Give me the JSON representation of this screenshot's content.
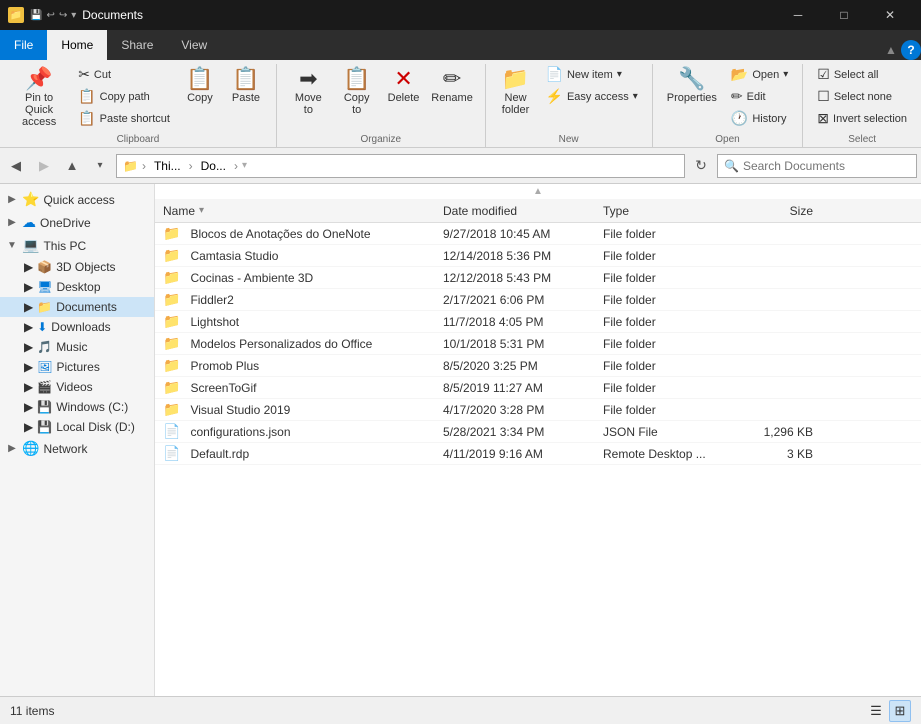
{
  "titleBar": {
    "title": "Documents",
    "controls": {
      "minimize": "─",
      "maximize": "□",
      "close": "✕"
    }
  },
  "ribbonTabs": [
    {
      "id": "file",
      "label": "File",
      "type": "file"
    },
    {
      "id": "home",
      "label": "Home",
      "type": "active"
    },
    {
      "id": "share",
      "label": "Share"
    },
    {
      "id": "view",
      "label": "View"
    }
  ],
  "ribbon": {
    "groups": {
      "clipboard": {
        "label": "Clipboard",
        "pinToQuickAccess": "Pin to Quick access",
        "copy": "Copy",
        "paste": "Paste",
        "cut": "Cut",
        "copyPath": "Copy path",
        "pasteShortcut": "Paste shortcut"
      },
      "organize": {
        "label": "Organize",
        "moveTo": "Move to",
        "copyTo": "Copy to",
        "delete": "Delete",
        "rename": "Rename"
      },
      "new": {
        "label": "New",
        "newFolder": "New folder",
        "newItem": "New item",
        "easyAccess": "Easy access"
      },
      "open": {
        "label": "Open",
        "properties": "Properties",
        "open": "Open",
        "edit": "Edit",
        "history": "History"
      },
      "select": {
        "label": "Select",
        "selectAll": "Select all",
        "selectNone": "Select none",
        "invertSelection": "Invert selection"
      }
    }
  },
  "addressBar": {
    "backDisabled": false,
    "forwardDisabled": true,
    "upLabel": "Up",
    "paths": [
      "This...",
      "Do...",
      ""
    ],
    "searchPlaceholder": "Search Documents",
    "refreshLabel": "Refresh"
  },
  "sidebar": {
    "items": [
      {
        "id": "quick-access",
        "label": "Quick access",
        "icon": "⭐",
        "expand": "▶",
        "expanded": false
      },
      {
        "id": "onedrive",
        "label": "OneDrive",
        "icon": "☁",
        "expand": "▶",
        "expanded": false
      },
      {
        "id": "this-pc",
        "label": "This PC",
        "icon": "💻",
        "expand": "▼",
        "expanded": true
      },
      {
        "id": "3d-objects",
        "label": "3D Objects",
        "icon": "📦",
        "expand": "▶",
        "child": true
      },
      {
        "id": "desktop",
        "label": "Desktop",
        "icon": "🖥",
        "expand": "▶",
        "child": true
      },
      {
        "id": "documents",
        "label": "Documents",
        "icon": "📁",
        "expand": "▶",
        "child": true,
        "active": true
      },
      {
        "id": "downloads",
        "label": "Downloads",
        "icon": "⬇",
        "expand": "▶",
        "child": true
      },
      {
        "id": "music",
        "label": "Music",
        "icon": "🎵",
        "expand": "▶",
        "child": true
      },
      {
        "id": "pictures",
        "label": "Pictures",
        "icon": "🖼",
        "expand": "▶",
        "child": true
      },
      {
        "id": "videos",
        "label": "Videos",
        "icon": "🎬",
        "expand": "▶",
        "child": true
      },
      {
        "id": "windows-c",
        "label": "Windows (C:)",
        "icon": "💾",
        "expand": "▶",
        "child": true
      },
      {
        "id": "local-disk-d",
        "label": "Local Disk (D:)",
        "icon": "💾",
        "expand": "▶",
        "child": true
      },
      {
        "id": "network",
        "label": "Network",
        "icon": "🌐",
        "expand": "▶",
        "expanded": false
      }
    ]
  },
  "fileList": {
    "columns": {
      "name": "Name",
      "dateModified": "Date modified",
      "type": "Type",
      "size": "Size"
    },
    "files": [
      {
        "name": "Blocos de Anotações do OneNote",
        "date": "9/27/2018 10:45 AM",
        "type": "File folder",
        "size": "",
        "icon": "📁"
      },
      {
        "name": "Camtasia Studio",
        "date": "12/14/2018 5:36 PM",
        "type": "File folder",
        "size": "",
        "icon": "📁"
      },
      {
        "name": "Cocinas - Ambiente 3D",
        "date": "12/12/2018 5:43 PM",
        "type": "File folder",
        "size": "",
        "icon": "📁"
      },
      {
        "name": "Fiddler2",
        "date": "2/17/2021 6:06 PM",
        "type": "File folder",
        "size": "",
        "icon": "📁"
      },
      {
        "name": "Lightshot",
        "date": "11/7/2018 4:05 PM",
        "type": "File folder",
        "size": "",
        "icon": "📁"
      },
      {
        "name": "Modelos Personalizados do Office",
        "date": "10/1/2018 5:31 PM",
        "type": "File folder",
        "size": "",
        "icon": "📁"
      },
      {
        "name": "Promob Plus",
        "date": "8/5/2020 3:25 PM",
        "type": "File folder",
        "size": "",
        "icon": "📁"
      },
      {
        "name": "ScreenToGif",
        "date": "8/5/2019 11:27 AM",
        "type": "File folder",
        "size": "",
        "icon": "📁"
      },
      {
        "name": "Visual Studio 2019",
        "date": "4/17/2020 3:28 PM",
        "type": "File folder",
        "size": "",
        "icon": "📁"
      },
      {
        "name": "configurations.json",
        "date": "5/28/2021 3:34 PM",
        "type": "JSON File",
        "size": "1,296 KB",
        "icon": "📄"
      },
      {
        "name": "Default.rdp",
        "date": "4/11/2019 9:16 AM",
        "type": "Remote Desktop ...",
        "size": "3 KB",
        "icon": "📄"
      }
    ]
  },
  "statusBar": {
    "itemCount": "11 items",
    "viewDetails": "details",
    "viewLarge": "large"
  }
}
